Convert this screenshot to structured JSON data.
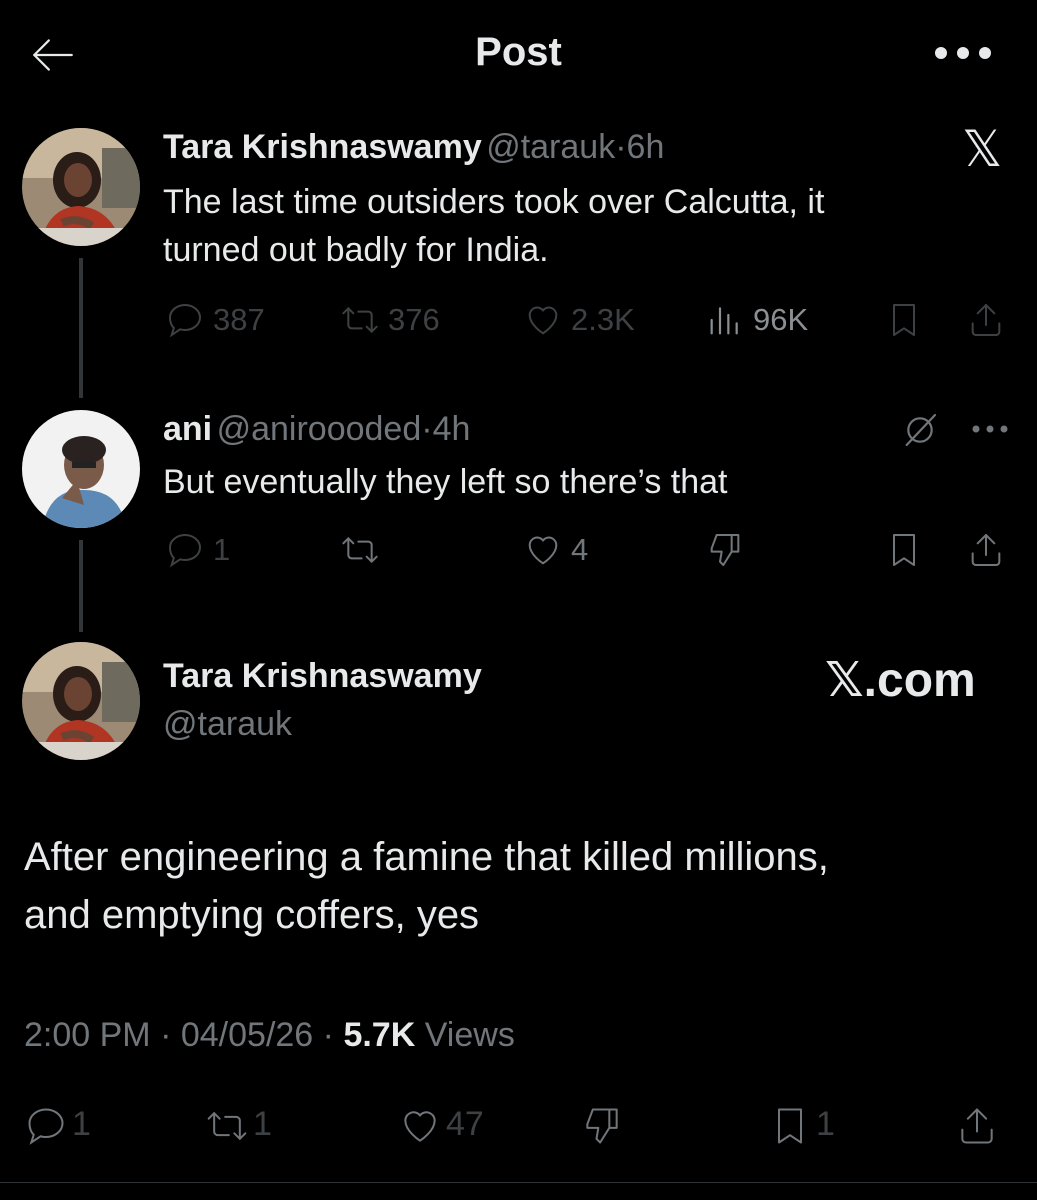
{
  "header": {
    "title": "Post",
    "back_icon": "arrow-left-icon",
    "more_icon": "more-horizontal-icon"
  },
  "thread": [
    {
      "author_name": "Tara Krishnaswamy",
      "handle": "@tarauk",
      "separator": "·",
      "time": "6h",
      "text_line1": "The last time outsiders took over Calcutta, it",
      "text_line2": "turned out badly for India.",
      "replies": "387",
      "reposts": "376",
      "likes": "2.3K",
      "views": "96K",
      "badge": "𝕏"
    },
    {
      "author_name": "ani",
      "handle": "@aniroooded",
      "separator": "·",
      "time": "4h",
      "text": "But eventually they left so there’s that",
      "replies": "1",
      "likes": "4"
    }
  ],
  "main_post": {
    "author_name": "Tara Krishnaswamy",
    "handle": "@tarauk",
    "watermark": "𝕏.com",
    "text_line1": "After engineering a famine that killed millions,",
    "text_line2": "and emptying coffers, yes",
    "time": "2:00 PM",
    "dot": "·",
    "date": "04/05/26",
    "views_count": "5.7K",
    "views_label": "Views",
    "replies": "1",
    "reposts": "1",
    "likes": "47",
    "bookmarks": "1"
  },
  "colors": {
    "background": "#000000",
    "text": "#e7e9ea",
    "muted": "#71767b"
  }
}
